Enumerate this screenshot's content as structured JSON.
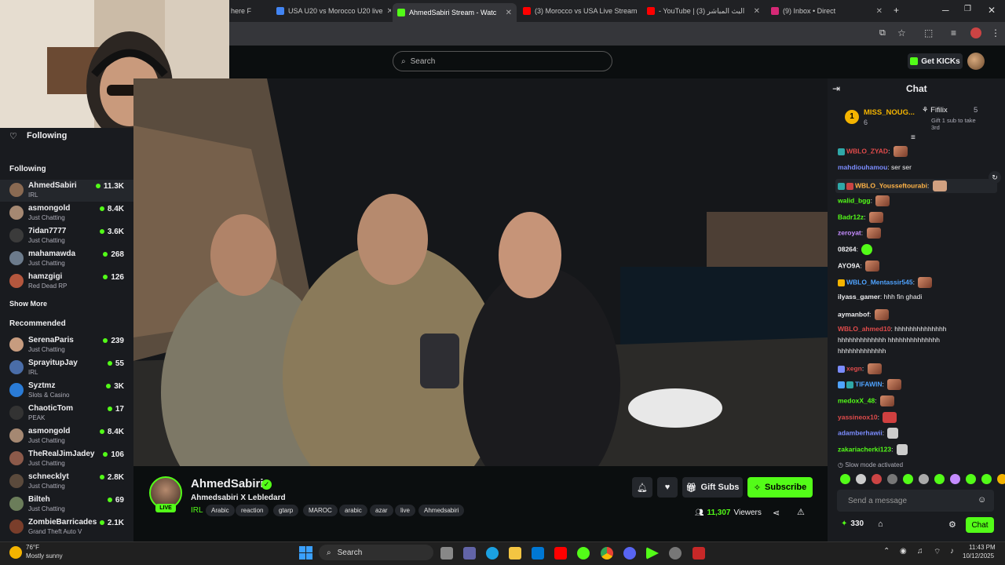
{
  "browser": {
    "tabs": [
      {
        "label": "here F",
        "icon": "tab-favicon",
        "color": "#5b6cf0"
      },
      {
        "label": "USA U20 vs Morocco U20 live",
        "icon": "tab-favicon",
        "color": "#4285f4"
      },
      {
        "label": "AhmedSabiri Stream - Watc",
        "icon": "kick-favicon",
        "color": "#53fc18",
        "active": true
      },
      {
        "label": "(3) Morocco vs USA Live Stream",
        "icon": "youtube-favicon",
        "color": "#ff0000"
      },
      {
        "label": "- YouTube | البث المباشر (3)",
        "icon": "youtube-favicon",
        "color": "#ff0000"
      },
      {
        "label": "(9) Inbox • Direct",
        "icon": "instagram-favicon",
        "color": "#d62976"
      }
    ]
  },
  "header": {
    "search_placeholder": "Search",
    "get_kicks": "Get KICKs"
  },
  "sidebar": {
    "following_title": "Following",
    "following_section": "Following",
    "following": [
      {
        "name": "AhmedSabiri",
        "category": "IRL",
        "viewers": "11.3K"
      },
      {
        "name": "asmongold",
        "category": "Just Chatting",
        "viewers": "8.4K"
      },
      {
        "name": "7idan7777",
        "category": "Just Chatting",
        "viewers": "3.6K"
      },
      {
        "name": "mahamawda",
        "category": "Just Chatting",
        "viewers": "268"
      },
      {
        "name": "hamzgigi",
        "category": "Red Dead RP",
        "viewers": "126"
      }
    ],
    "show_more": "Show More",
    "recommended_title": "Recommended",
    "recommended": [
      {
        "name": "SerenaParis",
        "category": "Just Chatting",
        "viewers": "239"
      },
      {
        "name": "SprayitupJay",
        "category": "IRL",
        "viewers": "55"
      },
      {
        "name": "Syztmz",
        "category": "Slots & Casino",
        "viewers": "3K"
      },
      {
        "name": "ChaoticTom",
        "category": "PEAK",
        "viewers": "17"
      },
      {
        "name": "asmongold",
        "category": "Just Chatting",
        "viewers": "8.4K"
      },
      {
        "name": "TheRealJimJadey",
        "category": "Just Chatting",
        "viewers": "106"
      },
      {
        "name": "schnecklyt",
        "category": "Just Chatting",
        "viewers": "2.8K"
      },
      {
        "name": "Bilteh",
        "category": "Just Chatting",
        "viewers": "69"
      },
      {
        "name": "ZombieBarricades",
        "category": "Grand Theft Auto V",
        "viewers": "2.1K"
      }
    ]
  },
  "stream": {
    "channel": "AhmedSabiri",
    "title": "Ahmedsabiri X Lebledard",
    "live_badge": "LIVE",
    "category": "IRL",
    "tags": [
      "Arabic",
      "reaction",
      "gtarp",
      "MAROC",
      "arabic",
      "azar",
      "live",
      "Ahmedsabiri"
    ],
    "gift_subs": "Gift Subs",
    "subscribe": "Subscribe",
    "viewers": "11,307",
    "viewers_label": "Viewers"
  },
  "chat": {
    "title": "Chat",
    "pinned": {
      "rank": "1",
      "user": "MISS_NOUG...",
      "user_count": "6",
      "gifter": "Fifilix",
      "gifter_count": "5",
      "gift_text_1": "Gift 1 sub to take",
      "gift_text_2": "3rd"
    },
    "messages": [
      {
        "user": "WBLO_ZYAD",
        "color": "#e04b4b",
        "text": ""
      },
      {
        "user": "mahdiouhamou",
        "color": "#7b8cff",
        "text": "ser ser"
      },
      {
        "user": "WBLO_Yousseftourabi",
        "color": "#ffb347",
        "text": ""
      },
      {
        "user": "walid_bgg",
        "color": "#53fc18",
        "text": ""
      },
      {
        "user": "Badr12z",
        "color": "#53fc18",
        "text": ""
      },
      {
        "user": "zeroyat",
        "color": "#c58cff",
        "text": ""
      },
      {
        "user": "08264",
        "color": "#ffffff",
        "text": ""
      },
      {
        "user": "AYO9A",
        "color": "#ffffff",
        "text": ""
      },
      {
        "user": "WBLO_Mentassir545",
        "color": "#4fa3ff",
        "text": ""
      },
      {
        "user": "ilyass_gamer",
        "color": "#efeff1",
        "text": "hhh fin ghadi"
      },
      {
        "user": "aymanbof",
        "color": "#efeff1",
        "text": ""
      },
      {
        "user": "WBLO_ahmed10",
        "color": "#e04b4b",
        "text": "hhhhhhhhhhhhhh"
      },
      {
        "user": "",
        "color": "#efeff1",
        "text": "hhhhhhhhhhhhh hhhhhhhhhhhhhh"
      },
      {
        "user": "",
        "color": "#efeff1",
        "text": "hhhhhhhhhhhhh"
      },
      {
        "user": "xegn",
        "color": "#e04b4b",
        "text": ""
      },
      {
        "user": "TIFAWIN",
        "color": "#4fa3ff",
        "text": ""
      },
      {
        "user": "medoxX_48",
        "color": "#53fc18",
        "text": ""
      },
      {
        "user": "yassineox10",
        "color": "#e04b4b",
        "text": ""
      },
      {
        "user": "adamberhawii",
        "color": "#7b8cff",
        "text": ""
      },
      {
        "user": "zakariacherki123",
        "color": "#53fc18",
        "text": ""
      }
    ],
    "slow_mode": "Slow mode activated",
    "input_placeholder": "Send a message",
    "points": "330",
    "send_label": "Chat"
  },
  "taskbar": {
    "weather_temp": "76°F",
    "weather_text": "Mostly sunny",
    "search": "Search",
    "time": "11:43 PM",
    "date": "10/12/2025"
  },
  "colors": {
    "accent": "#53fc18",
    "bg": "#0b0e0f",
    "panel": "#191b1f"
  }
}
